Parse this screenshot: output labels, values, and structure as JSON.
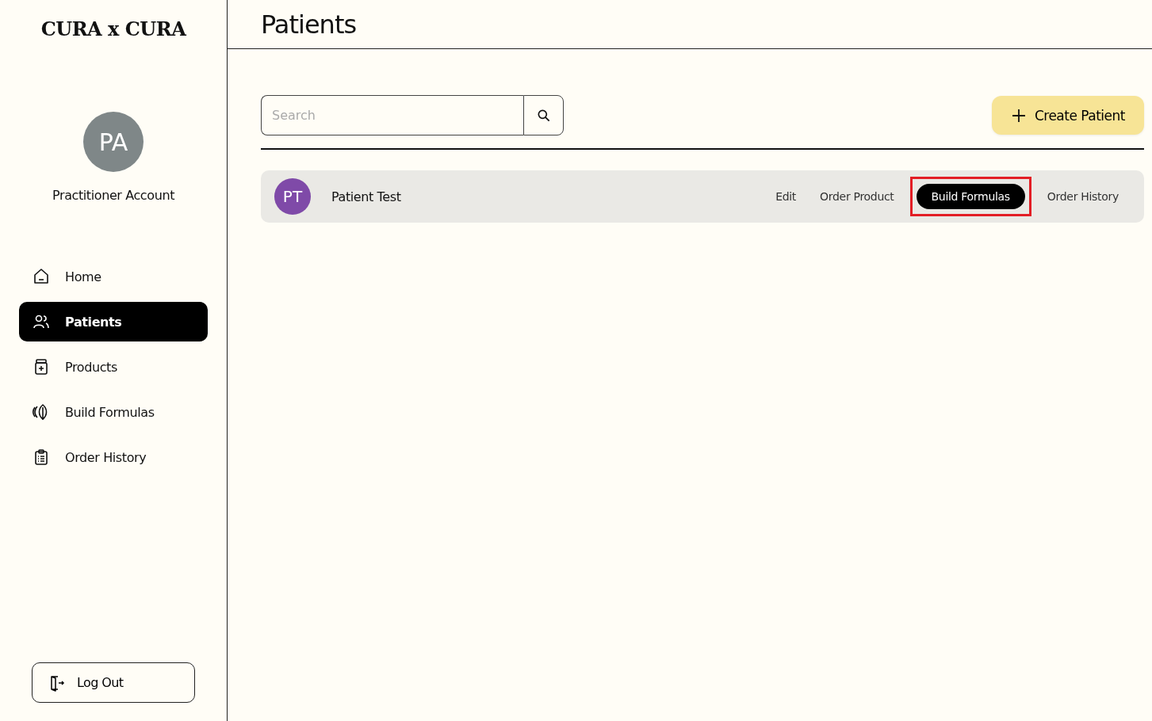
{
  "brand": "CURA x CURA",
  "account": {
    "initials": "PA",
    "name": "Practitioner Account",
    "color": "#7f8788"
  },
  "nav": [
    {
      "label": "Home",
      "selected": false
    },
    {
      "label": "Patients",
      "selected": true
    },
    {
      "label": "Products",
      "selected": false
    },
    {
      "label": "Build Formulas",
      "selected": false
    },
    {
      "label": "Order History",
      "selected": false
    }
  ],
  "logout": "Log Out",
  "page_title": "Patients",
  "search": {
    "placeholder": "Search"
  },
  "create_button": "Create Patient",
  "patients": [
    {
      "initials": "PT",
      "name": "Patient Test",
      "color": "#7f4aa8",
      "actions": [
        {
          "label": "Edit",
          "selected": false,
          "highlighted": false
        },
        {
          "label": "Order Product",
          "selected": false,
          "highlighted": false
        },
        {
          "label": "Build Formulas",
          "selected": true,
          "highlighted": true
        },
        {
          "label": "Order History",
          "selected": false,
          "highlighted": false
        }
      ]
    }
  ]
}
